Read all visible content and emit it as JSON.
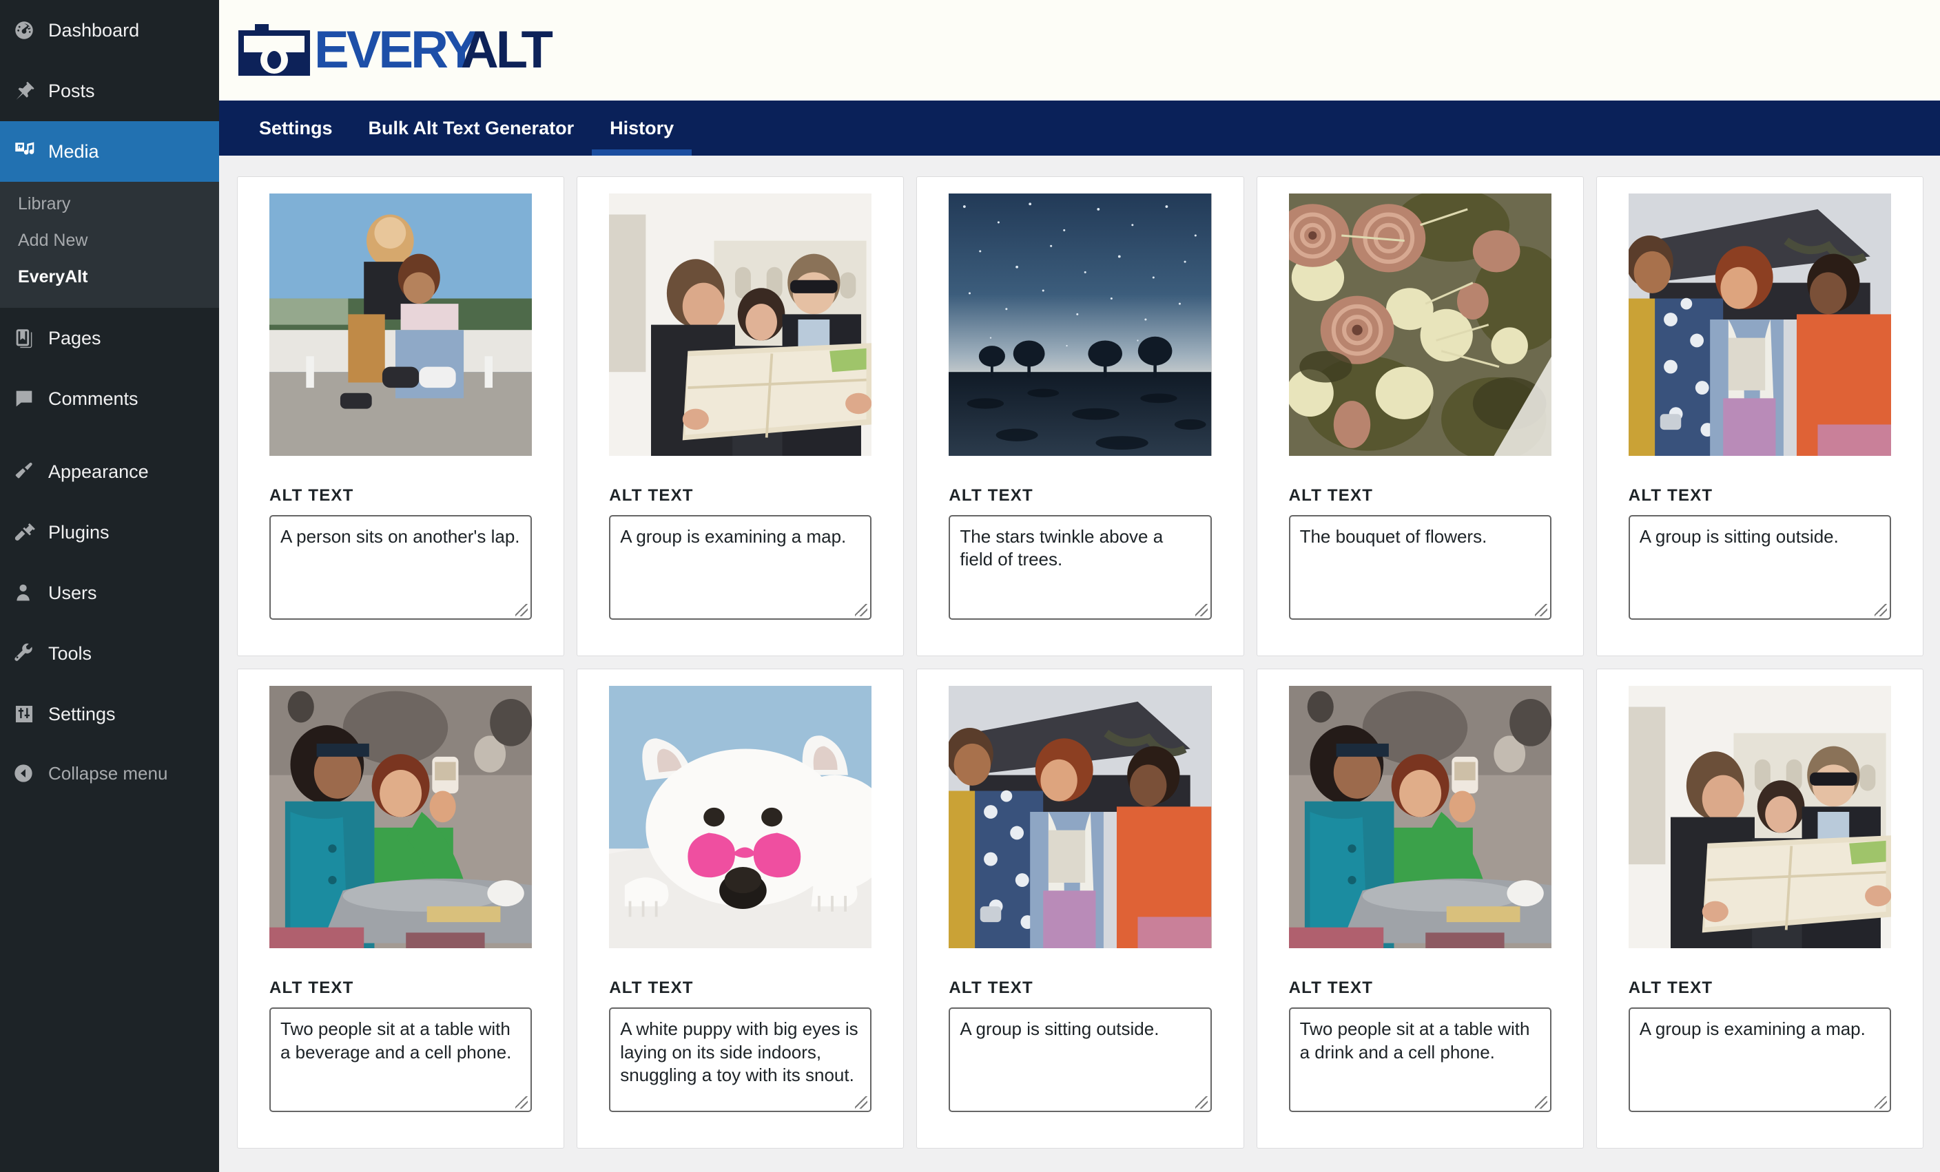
{
  "sidebar": {
    "items": [
      {
        "label": "Dashboard",
        "icon": "dashboard-icon"
      },
      {
        "label": "Posts",
        "icon": "pin-icon"
      },
      {
        "label": "Media",
        "icon": "media-icon",
        "current": true
      },
      {
        "label": "Pages",
        "icon": "pages-icon"
      },
      {
        "label": "Comments",
        "icon": "comments-icon"
      },
      {
        "label": "Appearance",
        "icon": "brush-icon"
      },
      {
        "label": "Plugins",
        "icon": "plug-icon"
      },
      {
        "label": "Users",
        "icon": "user-icon"
      },
      {
        "label": "Tools",
        "icon": "wrench-icon"
      },
      {
        "label": "Settings",
        "icon": "settings-icon"
      }
    ],
    "media_submenu": [
      {
        "label": "Library",
        "active": false
      },
      {
        "label": "Add New",
        "active": false
      },
      {
        "label": "EveryAlt",
        "active": true
      }
    ],
    "collapse_label": "Collapse menu",
    "collapse_icon": "collapse-arrow-icon"
  },
  "brand": {
    "icon": "camera-icon",
    "name_part1": "EVERY",
    "name_part2": "ALT",
    "color_primary": "#1d4fa8",
    "color_secondary": "#0d2259"
  },
  "nav": {
    "tabs": [
      {
        "label": "Settings",
        "active": false
      },
      {
        "label": "Bulk Alt Text Generator",
        "active": false
      },
      {
        "label": "History",
        "active": true
      }
    ],
    "bar_color": "#0a2159",
    "active_underline_color": "#1b4ea0"
  },
  "history": {
    "alt_text_label": "ALT TEXT",
    "cards": [
      {
        "image": "two-people-on-ledge",
        "alt_text": "A person sits on another's lap."
      },
      {
        "image": "group-reading-map",
        "alt_text": "A group is examining a map."
      },
      {
        "image": "starry-night-trees",
        "alt_text": "The stars twinkle above a field of trees."
      },
      {
        "image": "dried-flower-bouquet",
        "alt_text": "The bouquet of flowers."
      },
      {
        "image": "friends-sitting-outside",
        "alt_text": "A group is sitting outside."
      },
      {
        "image": "two-women-cafe-phone",
        "alt_text": "Two people sit at a table with a beverage and a cell phone."
      },
      {
        "image": "white-puppy-heart-glasses",
        "alt_text": "A white puppy with big eyes is laying on its side indoors, snuggling a toy with its snout."
      },
      {
        "image": "friends-sitting-outside",
        "alt_text": "A group is sitting outside."
      },
      {
        "image": "two-women-cafe-phone",
        "alt_text": "Two people sit at a table with a drink and a cell phone."
      },
      {
        "image": "group-reading-map",
        "alt_text": "A group is examining a map."
      }
    ]
  }
}
